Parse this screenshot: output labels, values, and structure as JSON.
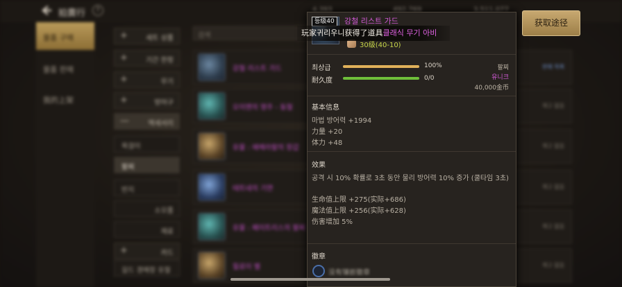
{
  "top_bar": {
    "title": "拍賣行",
    "help": "?",
    "currency_1": "4,393",
    "currency_2": "492,769",
    "currency_3": "3,511,077"
  },
  "left_nav": [
    {
      "label": "물품 구매",
      "active": true
    },
    {
      "label": "물품 판매",
      "active": false
    },
    {
      "label": "我的上架",
      "active": false
    }
  ],
  "categories": [
    {
      "label": "세트 상품",
      "kind": "plus"
    },
    {
      "label": "기간 한정",
      "kind": "plus"
    },
    {
      "label": "무기",
      "kind": "plus"
    },
    {
      "label": "방어구",
      "kind": "plus"
    },
    {
      "label": "액세서리",
      "kind": "minus"
    }
  ],
  "subcategories": [
    {
      "label": "목걸이",
      "selected": false
    },
    {
      "label": "팔찌",
      "selected": true
    },
    {
      "label": "반지",
      "selected": false
    },
    {
      "label": "소모품",
      "selected": false
    },
    {
      "label": "재료",
      "selected": false
    },
    {
      "label": "카드",
      "selected": false
    },
    {
      "label": "길드 경매장 유절",
      "selected": false
    }
  ],
  "search": {
    "placeholder": "검색"
  },
  "list_rows": [
    {
      "name": "강철 리스트 가드",
      "right": "판매 목록",
      "right_hl": true
    },
    {
      "name": "오이엔의 영주 - 동철",
      "right": "재고 없음",
      "right_hl": false
    },
    {
      "name": "유물 : 에메라랄의 장갑",
      "right": "재고 없음",
      "right_hl": false
    },
    {
      "name": "테트네의 기연",
      "right": "재고 없음",
      "right_hl": false
    },
    {
      "name": "유물 : 페이트리스의 팔찌",
      "right": "재고 없음",
      "right_hl": false
    },
    {
      "name": "힐로이 벨",
      "right": "재고 없음",
      "right_hl": false
    }
  ],
  "tooltip": {
    "level_badge": "등级40",
    "name": "강철 리스트 가드",
    "level_req": "30级(40-10)",
    "stats": [
      {
        "label": "최상급",
        "value": "100%",
        "fill": 1.0,
        "color": "#e0b15a"
      },
      {
        "label": "耐久度",
        "value": "0/0",
        "fill": 1.0,
        "color": "#6fbf3a"
      }
    ],
    "slot": "팔찌",
    "rarity": "유니크",
    "price": "40,000金币",
    "basic_title": "基本信息",
    "basic_lines": [
      "마법 방어력 +1994",
      "力量 +20",
      "体力 +48"
    ],
    "effect_title": "效果",
    "effect_lines": [
      "공격 시 10% 확률로 3초 동안 물리 방어력 10% 증가 (쿨타임 3초)",
      "",
      "生命值上限 +275(实际+686)",
      "魔法值上限 +256(实际+628)",
      "伤害增加 5%"
    ],
    "emblem_title": "徽章",
    "emblem_text": "没有镶嵌徽章"
  },
  "notification": {
    "prefix": "玩家",
    "player": "귀리우니",
    "middle": "获得了道具",
    "item": "클래식 무기 아비"
  },
  "get_button": {
    "label": "获取途径"
  },
  "colors": {
    "accent": "#c7a870",
    "rarity_purple": "#d25ad6",
    "unique": "#d25ad6"
  }
}
